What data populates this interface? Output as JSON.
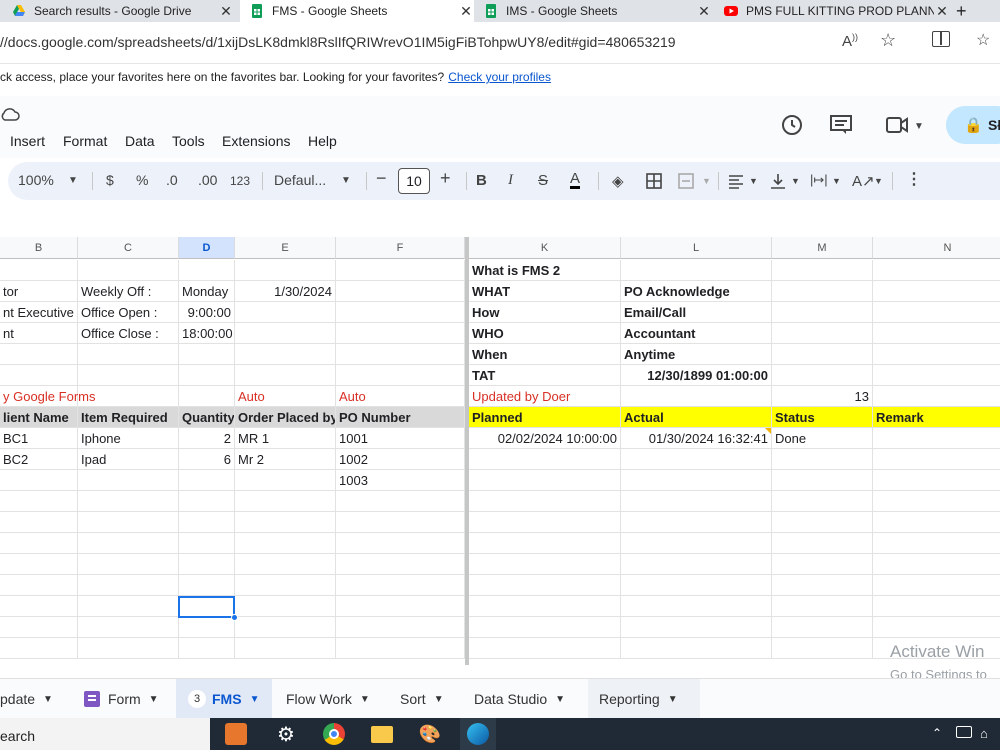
{
  "browser": {
    "tabs": [
      {
        "title": "Search results - Google Drive",
        "icon": "google-drive-icon"
      },
      {
        "title": "FMS - Google Sheets",
        "icon": "google-sheets-icon",
        "active": true
      },
      {
        "title": "IMS - Google Sheets",
        "icon": "google-sheets-icon"
      },
      {
        "title": "PMS FULL KITTING PROD PLANN",
        "icon": "youtube-icon"
      }
    ],
    "url": "//docs.google.com/spreadsheets/d/1xijDsLK8dmkl8RslIfQRIWrevO1IM5igFiBTohpwUY8/edit#gid=480653219",
    "favorites_bar_text": "ck access, place your favorites here on the favorites bar. Looking for your favorites?",
    "favorites_link": "Check your profiles"
  },
  "menu": [
    "Insert",
    "Format",
    "Data",
    "Tools",
    "Extensions",
    "Help"
  ],
  "share_label": "Sł",
  "toolbar": {
    "zoom": "100%",
    "currency": "$",
    "percent": "%",
    "dec_decrease": ".0",
    "dec_increase": ".00",
    "number_format": "123",
    "font": "Defaul...",
    "font_size": "10"
  },
  "columns": [
    {
      "label": "B"
    },
    {
      "label": "C"
    },
    {
      "label": "D",
      "selected": true
    },
    {
      "label": "E"
    },
    {
      "label": "F"
    },
    {
      "label": "K"
    },
    {
      "label": "L"
    },
    {
      "label": "M"
    },
    {
      "label": "N"
    }
  ],
  "cells": {
    "what_is": "What is FMS 2",
    "rows": {
      "r2": {
        "B": "tor",
        "C": "Weekly Off :",
        "D": "Monday",
        "E": "1/30/2024",
        "K": "WHAT",
        "L": "PO Acknowledge"
      },
      "r3": {
        "B": "nt Executive",
        "C": "Office Open :",
        "D": "9:00:00",
        "K": "How",
        "L": "Email/Call"
      },
      "r4": {
        "B": "nt",
        "C": "Office Close :",
        "D": "18:00:00",
        "K": "WHO",
        "L": "Accountant"
      },
      "r5": {
        "K": "When",
        "L": "Anytime"
      },
      "r6": {
        "K": "TAT",
        "L": "12/30/1899 01:00:00"
      },
      "r7": {
        "B": "y Google Forms",
        "E": "Auto",
        "F": "Auto",
        "K": "Updated by Doer",
        "M": "13"
      }
    },
    "header_left": [
      "lient Name",
      "Item Required",
      "Quantity",
      "Order Placed by",
      "PO Number"
    ],
    "header_right": [
      "Planned",
      "Actual",
      "Status",
      "Remark"
    ],
    "data_rows": [
      {
        "client": "BC1",
        "item": "Iphone",
        "qty": "2",
        "placed_by": "MR 1",
        "po": "1001",
        "planned": "02/02/2024 10:00:00",
        "actual": "01/30/2024 16:32:41",
        "status": "Done"
      },
      {
        "client": "BC2",
        "item": "Ipad",
        "qty": "6",
        "placed_by": "Mr 2",
        "po": "1002"
      },
      {
        "po": "1003"
      }
    ]
  },
  "sheet_tabs": [
    {
      "label": "pdate"
    },
    {
      "label": "Form"
    },
    {
      "label": "FMS",
      "badge": "3",
      "active": true
    },
    {
      "label": "Flow Work"
    },
    {
      "label": "Sort"
    },
    {
      "label": "Data Studio"
    },
    {
      "label": "Reporting"
    }
  ],
  "taskbar": {
    "search": "earch"
  },
  "watermark": {
    "line1": "Activate Win",
    "line2": "Go to Settings to"
  }
}
